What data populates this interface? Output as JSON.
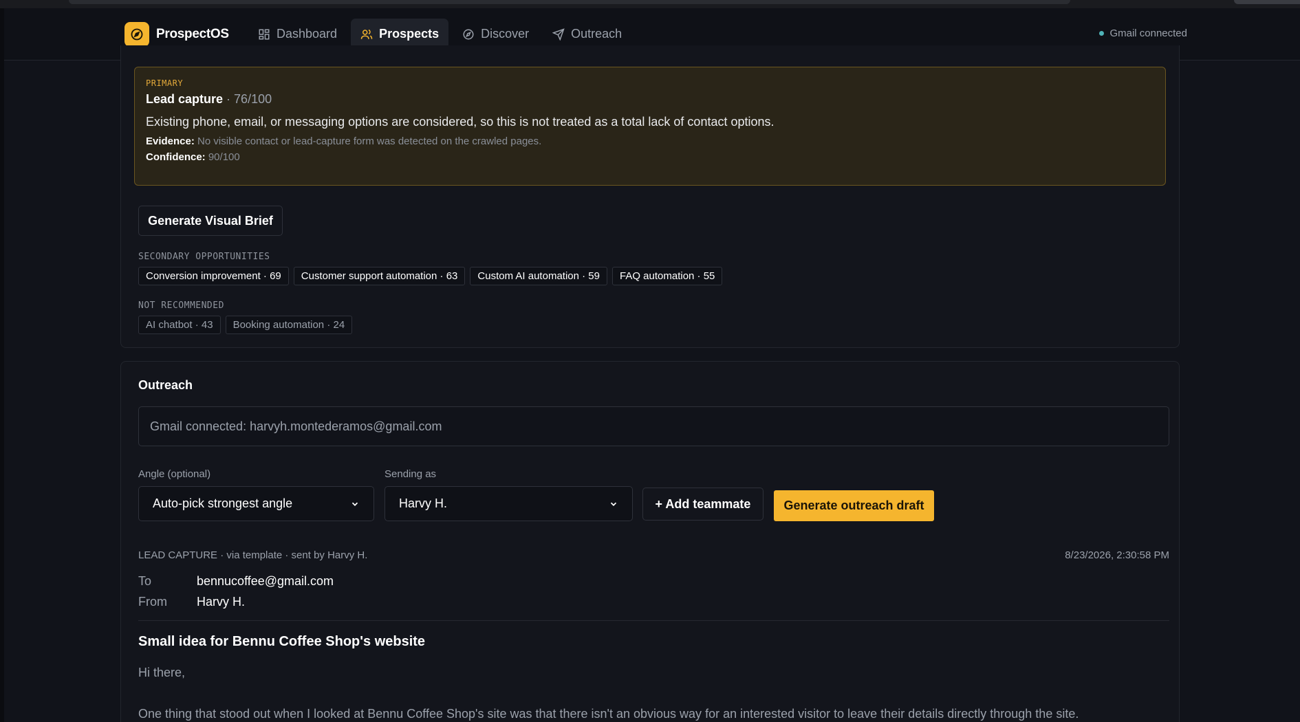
{
  "nav": {
    "brand": "ProspectOS",
    "items": [
      {
        "label": "Dashboard",
        "icon": "grid-icon"
      },
      {
        "label": "Prospects",
        "icon": "users-icon"
      },
      {
        "label": "Discover",
        "icon": "compass-icon"
      },
      {
        "label": "Outreach",
        "icon": "send-icon"
      }
    ],
    "active": "Prospects",
    "gmail_status": "Gmail connected"
  },
  "primary": {
    "tag": "PRIMARY",
    "title": "Lead capture",
    "score": " · 76/100",
    "description": "Existing phone, email, or messaging options are considered, so this is not treated as a total lack of contact options.",
    "evidence_label": "Evidence:",
    "evidence_text": " No visible contact or lead-capture form was detected on the crawled pages.",
    "confidence_label": "Confidence:",
    "confidence_text": " 90/100"
  },
  "visual_brief_button": "Generate Visual Brief",
  "secondary": {
    "label": "SECONDARY OPPORTUNITIES",
    "chips": [
      "Conversion improvement · 69",
      "Customer support automation · 63",
      "Custom AI automation · 59",
      "FAQ automation · 55"
    ]
  },
  "not_recommended": {
    "label": "NOT RECOMMENDED",
    "chips": [
      "AI chatbot · 43",
      "Booking automation · 24"
    ]
  },
  "outreach": {
    "title": "Outreach",
    "gmail_field": "Gmail connected: harvyh.montederamos@gmail.com",
    "angle_label": "Angle (optional)",
    "angle_value": "Auto-pick strongest angle",
    "sending_label": "Sending as",
    "sending_value": "Harvy H.",
    "add_teammate": "+ Add teammate",
    "generate": "Generate outreach draft"
  },
  "draft": {
    "meta": "LEAD CAPTURE · via template · sent by Harvy H.",
    "date": "8/23/2026, 2:30:58 PM",
    "to_label": "To",
    "to_value": "bennucoffee@gmail.com",
    "from_label": "From",
    "from_value": "Harvy H.",
    "subject": "Small idea for Bennu Coffee Shop's website",
    "greeting": "Hi there,",
    "body_line": "One thing that stood out when I looked at Bennu Coffee Shop's site was that there isn't an obvious way for an interested visitor to leave their details directly through the site."
  },
  "colors": {
    "accent": "#f5b52e",
    "primary_border": "#6b5620",
    "status_dot": "#4fb3b8"
  }
}
